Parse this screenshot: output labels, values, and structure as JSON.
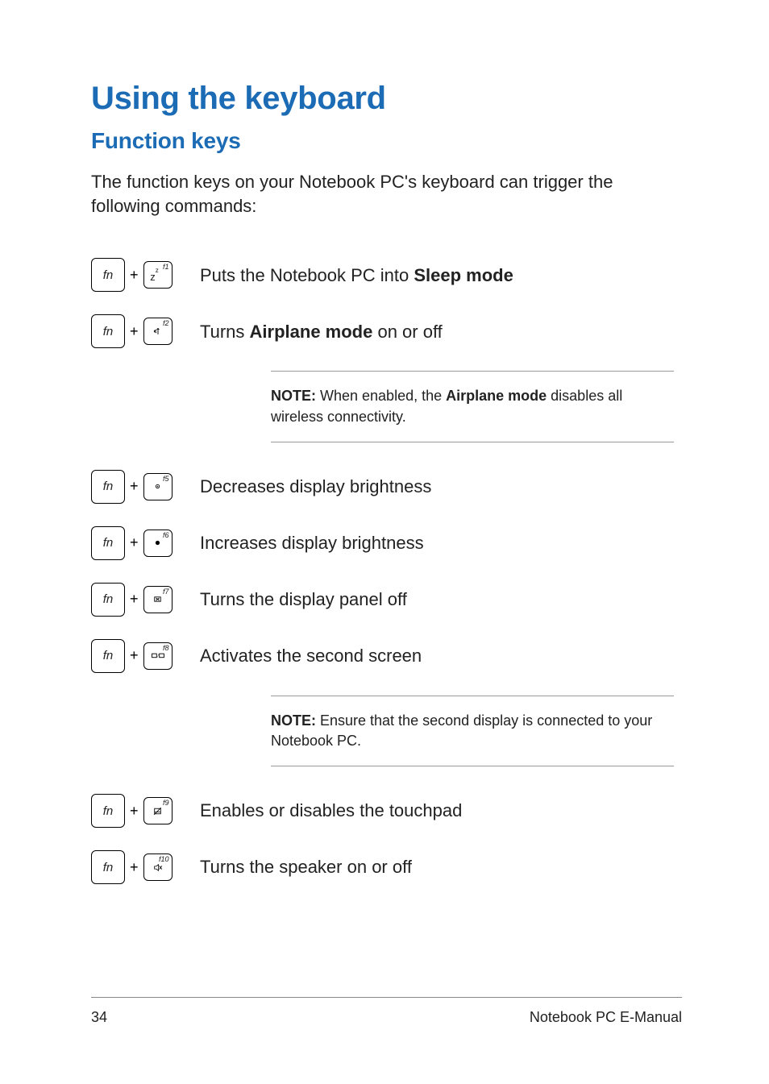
{
  "heading": "Using the keyboard",
  "subheading": "Function keys",
  "intro": "The function keys on your Notebook PC's keyboard can trigger the following commands:",
  "fn_label": "fn",
  "plus": "+",
  "rows": {
    "f1": {
      "flabel": "f1",
      "icon_text": "z",
      "desc_pre": "Puts the Notebook PC into ",
      "desc_bold": "Sleep mode",
      "desc_post": ""
    },
    "f2": {
      "flabel": "f2",
      "desc_pre": "Turns ",
      "desc_bold": "Airplane mode",
      "desc_post": " on or off"
    },
    "f5": {
      "flabel": "f5",
      "desc": "Decreases display brightness"
    },
    "f6": {
      "flabel": "f6",
      "desc": "Increases display brightness"
    },
    "f7": {
      "flabel": "f7",
      "desc": "Turns the display panel off"
    },
    "f8": {
      "flabel": "f8",
      "desc": "Activates the second screen"
    },
    "f9": {
      "flabel": "f9",
      "desc": "Enables or disables the touchpad"
    },
    "f10": {
      "flabel": "f10",
      "desc": "Turns the speaker on or off"
    }
  },
  "note1": {
    "label": "NOTE:",
    "pre": " When enabled, the ",
    "bold": "Airplane mode",
    "post": " disables all wireless connectivity."
  },
  "note2": {
    "label": "NOTE:",
    "text": " Ensure that the second display is connected to your Notebook PC."
  },
  "footer": {
    "page": "34",
    "title": "Notebook PC E-Manual"
  }
}
